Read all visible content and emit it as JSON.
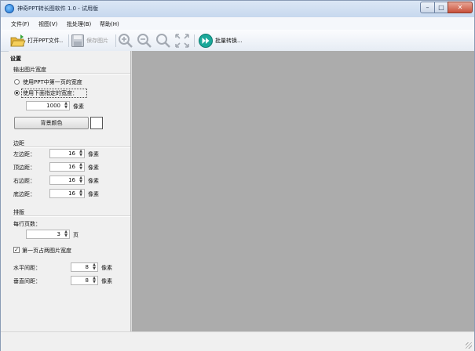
{
  "window": {
    "title": "神奇PPT转长图软件 1.0 - 试用版"
  },
  "menu": [
    "文件(F)",
    "视图(V)",
    "批处理(B)",
    "帮助(H)"
  ],
  "toolbar": {
    "open": "打开PPT文件..",
    "save": "保存图片",
    "batch": "批量转换..."
  },
  "panel": {
    "title": "设置",
    "width_group": "输出图片宽度",
    "radio_first": "使用PPT中第一页的宽度",
    "radio_custom": "使用下面指定的宽度：",
    "width_value": "1000",
    "width_unit": "像素",
    "bg_button": "背景颜色",
    "bg_color": "#ffffff",
    "margin_group": "边距",
    "margins": [
      {
        "label": "左边距：",
        "value": "16",
        "unit": "像素"
      },
      {
        "label": "顶边距：",
        "value": "16",
        "unit": "像素"
      },
      {
        "label": "右边距：",
        "value": "16",
        "unit": "像素"
      },
      {
        "label": "底边距：",
        "value": "16",
        "unit": "像素"
      }
    ],
    "layout_group": "排版",
    "pages_per_row_label": "每行页数：",
    "pages_per_row_value": "3",
    "pages_unit": "页",
    "first_page_check": "第一页占两图片宽度",
    "h_gap_label": "水平间距：",
    "h_gap_value": "8",
    "h_gap_unit": "像素",
    "v_gap_label": "垂直间距：",
    "v_gap_value": "8",
    "v_gap_unit": "像素"
  },
  "icons": [
    "app-icon",
    "folder-open-icon",
    "save-icon",
    "zoom-in-icon",
    "zoom-out-icon",
    "zoom-reset-icon",
    "fit-icon",
    "batch-convert-icon"
  ],
  "colors": {
    "preview_bg": "#acacac",
    "panel_bg": "#f0f0f0",
    "batch_icon": "#1aa89a"
  }
}
